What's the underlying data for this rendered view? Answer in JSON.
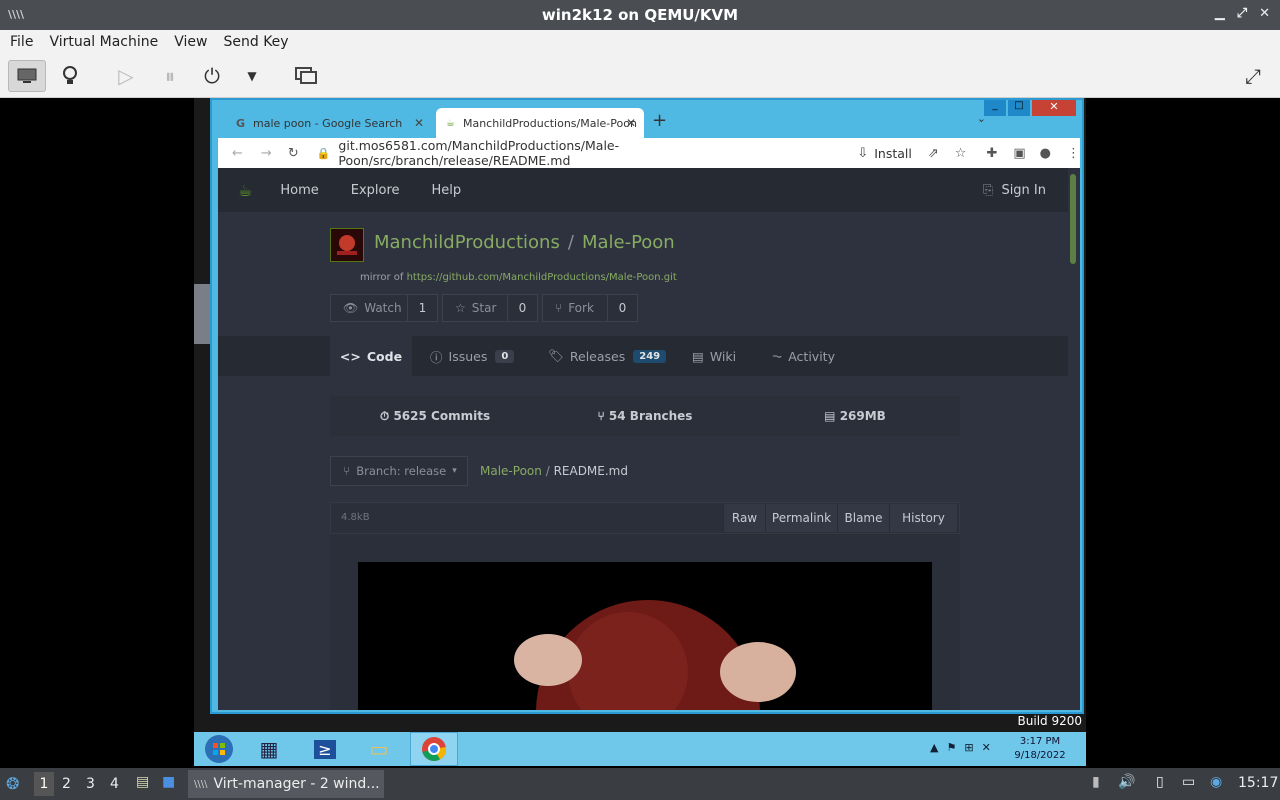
{
  "host": {
    "title": "win2k12 on QEMU/KVM",
    "menu": [
      "File",
      "Virtual Machine",
      "View",
      "Send Key"
    ],
    "build": "Build 9200"
  },
  "browser": {
    "tab1": "male poon - Google Search",
    "tab2": "ManchildProductions/Male-Poon",
    "url": "git.mos6581.com/ManchildProductions/Male-Poon/src/branch/release/README.md",
    "install": "Install"
  },
  "gitea": {
    "nav": {
      "home": "Home",
      "explore": "Explore",
      "help": "Help",
      "signin": "Sign In"
    },
    "owner": "ManchildProductions",
    "sep": "/",
    "repo": "Male-Poon",
    "mirror_label": "mirror of",
    "mirror_url": "https://github.com/ManchildProductions/Male-Poon.git",
    "watch": {
      "label": "Watch",
      "count": "1"
    },
    "star": {
      "label": "Star",
      "count": "0"
    },
    "fork": {
      "label": "Fork",
      "count": "0"
    },
    "tabs": {
      "code": "Code",
      "issues": "Issues",
      "issues_count": "0",
      "releases": "Releases",
      "releases_count": "249",
      "wiki": "Wiki",
      "activity": "Activity"
    },
    "stats": {
      "commits": "5625 Commits",
      "branches": "54 Branches",
      "size": "269MB"
    },
    "branch": "Branch: release",
    "path_repo": "Male-Poon",
    "path_file": "README.md",
    "file_size": "4.8kB",
    "file_btns": {
      "raw": "Raw",
      "permalink": "Permalink",
      "blame": "Blame",
      "history": "History"
    }
  },
  "guest_taskbar": {
    "time": "3:17 PM",
    "date": "9/18/2022"
  },
  "host_panel": {
    "workspaces": [
      "1",
      "2",
      "3",
      "4"
    ],
    "task": "Virt-manager - 2 wind...",
    "clock": "15:17"
  },
  "colors": {
    "accent_blue": "#4fb9e4",
    "gitea_green": "#87ab63",
    "dark_bg": "#2e323e"
  }
}
